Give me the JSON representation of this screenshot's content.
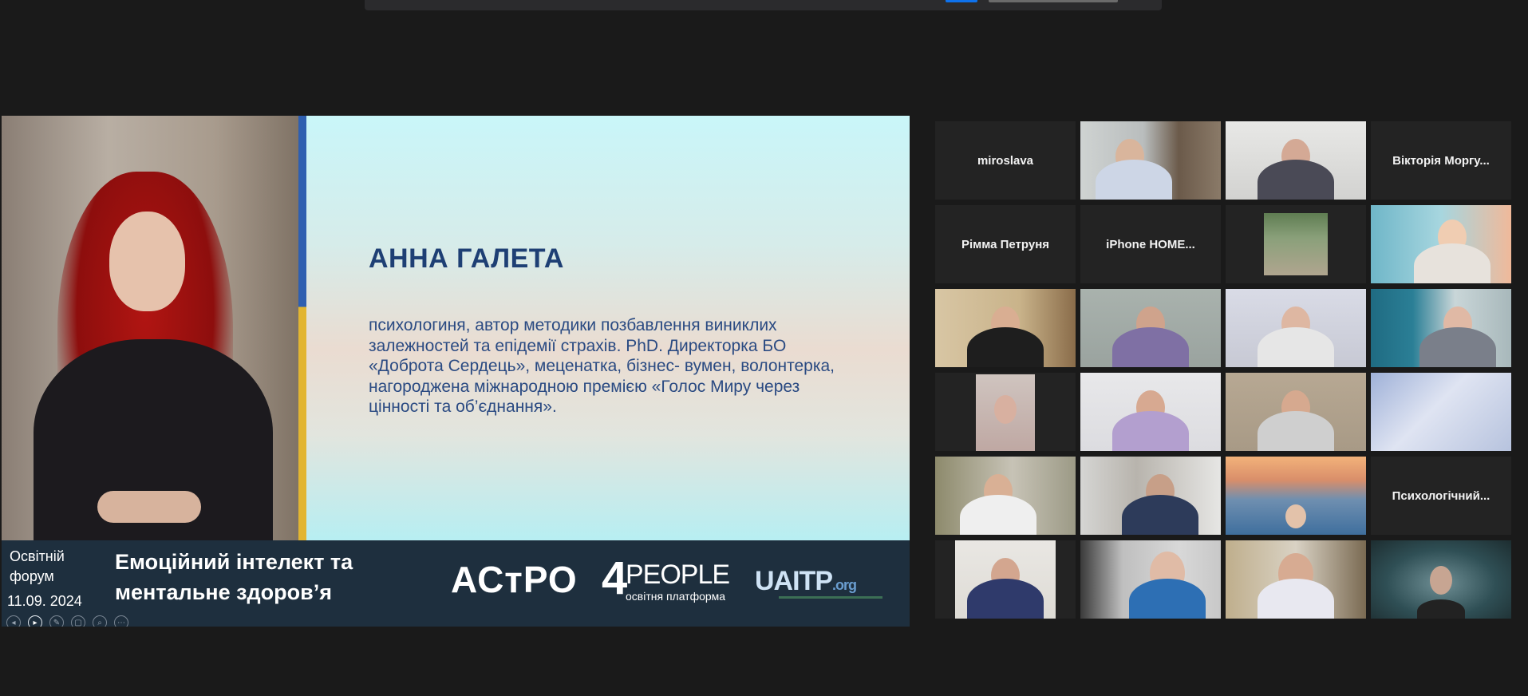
{
  "shared_screen": {
    "slide": {
      "speaker_name": "АННА ГАЛЕТА",
      "speaker_bio": "психологиня, автор методики позбавлення виниклих залежностей та епідемії страхів. PhD. Директорка БО «Доброта Сердець», меценатка, бізнес- вумен, волонтерка, нагороджена міжнародною премією «Голос Миру через цінності та об’єднання»."
    },
    "banner": {
      "forum_label": "Освітній форум",
      "date": "11.09. 2024",
      "event_title": "Емоційний інтелект та ментальне здоров’я",
      "logo_astro": "АСтРО",
      "logo_4people_number": "4",
      "logo_4people_word": "PEOPLE",
      "logo_4people_sub": "освітня платформа",
      "logo_uaitp": "UAITP",
      "logo_uaitp_domain": ".org"
    },
    "controls": [
      "prev-icon",
      "next-icon",
      "pen-icon",
      "copy-icon",
      "zoom-icon",
      "more-icon"
    ]
  },
  "participants": [
    {
      "name": "miroslava",
      "video": false
    },
    {
      "name": "",
      "video": true
    },
    {
      "name": "",
      "video": true
    },
    {
      "name": "Вікторія  Моргу...",
      "video": false
    },
    {
      "name": "Рімма Петруня",
      "video": false
    },
    {
      "name": "iPhone  HOME...",
      "video": false
    },
    {
      "name": "",
      "video": true
    },
    {
      "name": "",
      "video": true,
      "active_speaker": true
    },
    {
      "name": "",
      "video": true
    },
    {
      "name": "",
      "video": true
    },
    {
      "name": "",
      "video": true
    },
    {
      "name": "",
      "video": true
    },
    {
      "name": "",
      "video": true
    },
    {
      "name": "",
      "video": true
    },
    {
      "name": "",
      "video": true
    },
    {
      "name": "",
      "video": true
    },
    {
      "name": "",
      "video": true
    },
    {
      "name": "",
      "video": true
    },
    {
      "name": "",
      "video": true
    },
    {
      "name": "Психологічний...",
      "video": false
    },
    {
      "name": "",
      "video": true
    },
    {
      "name": "",
      "video": true
    },
    {
      "name": "",
      "video": true
    },
    {
      "name": "",
      "video": true
    }
  ],
  "colors": {
    "background": "#1a1a1a",
    "tile": "#232323",
    "active_speaker_border": "#e3e67a",
    "slide_title": "#1e3f74",
    "banner": "#1e2f3e"
  }
}
